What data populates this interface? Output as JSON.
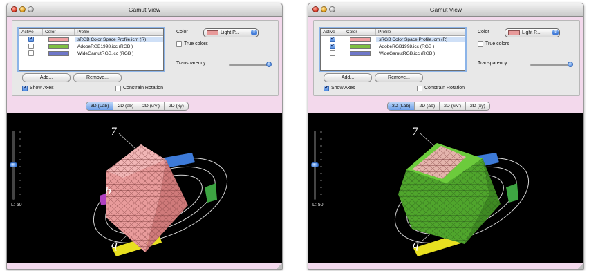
{
  "windows": [
    {
      "title": "Gamut View",
      "table": {
        "headers": [
          "Active",
          "Color",
          "Profile"
        ],
        "rows": [
          {
            "active": true,
            "color": "#f0a0a2",
            "profile": "sRGB Color Space Profile.icm (R)"
          },
          {
            "active": false,
            "color": "#7fc042",
            "profile": "AdobeRGB1998.icc (RGB )"
          },
          {
            "active": false,
            "color": "#6f77c9",
            "profile": "WideGamutRGB.icc (RGB )"
          }
        ]
      },
      "buttons": {
        "add": "Add...",
        "remove": "Remove..."
      },
      "show_axes": "Show Axes",
      "constrain_rotation": "Constrain Rotation",
      "color_label": "Color",
      "color_select": "Light P...",
      "true_colors": "True colors",
      "transparency_label": "Transparency",
      "tabs": [
        "3D (Lab)",
        "2D (ab)",
        "2D (u'v')",
        "2D (xy)"
      ],
      "active_tab": "3D (Lab)",
      "l_value": "L: 50",
      "axis_labels": [
        "7",
        "b",
        "q"
      ]
    },
    {
      "title": "Gamut View",
      "table": {
        "headers": [
          "Active",
          "Color",
          "Profile"
        ],
        "rows": [
          {
            "active": true,
            "color": "#f0a0a2",
            "profile": "sRGB Color Space Profile.icm (R)"
          },
          {
            "active": true,
            "color": "#7fc042",
            "profile": "AdobeRGB1998.icc (RGB )"
          },
          {
            "active": false,
            "color": "#6f77c9",
            "profile": "WideGamutRGB.icc (RGB )"
          }
        ]
      },
      "buttons": {
        "add": "Add...",
        "remove": "Remove..."
      },
      "show_axes": "Show Axes",
      "constrain_rotation": "Constrain Rotation",
      "color_label": "Color",
      "color_select": "Light P...",
      "true_colors": "True colors",
      "transparency_label": "Transparency",
      "tabs": [
        "3D (Lab)",
        "2D (ab)",
        "2D (u'v')",
        "2D (xy)"
      ],
      "active_tab": "3D (Lab)",
      "l_value": "L: 50",
      "axis_labels": [
        "7",
        "q"
      ]
    }
  ]
}
